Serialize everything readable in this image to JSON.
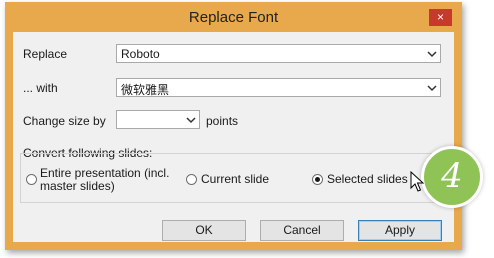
{
  "window": {
    "title": "Replace Font",
    "close_glyph": "×"
  },
  "form": {
    "replace_label": "Replace",
    "replace_value": "Roboto",
    "with_label": "... with",
    "with_value": "微软雅黑",
    "size_label": "Change size by",
    "size_value": "",
    "size_unit": "points"
  },
  "convert": {
    "legend": "Convert following slides:",
    "options": [
      {
        "label_line1": "Entire presentation (incl.",
        "label_line2": "master slides)",
        "selected": false
      },
      {
        "label": "Current slide",
        "selected": false
      },
      {
        "label": "Selected slides",
        "selected": true
      }
    ]
  },
  "buttons": {
    "ok": "OK",
    "cancel": "Cancel",
    "apply": "Apply"
  },
  "badge": {
    "number": "4",
    "color": "#8fc356"
  },
  "colors": {
    "title_bar": "#e8a84c",
    "close": "#c7392b",
    "dialog_bg": "#f0f0f0"
  }
}
